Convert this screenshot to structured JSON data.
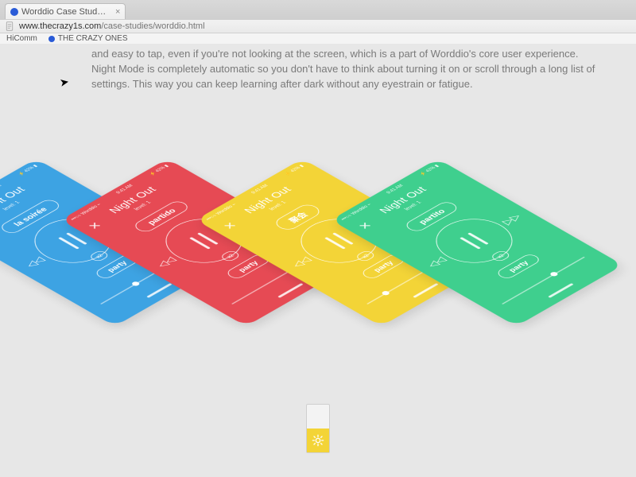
{
  "browser": {
    "tab_title": "Worddio Case Study – The",
    "url_host": "www.thecrazy1s.com",
    "url_path": "/case-studies/worddio.html",
    "bookmarks": [
      {
        "label": "HiComm",
        "has_dot": false
      },
      {
        "label": "THE CRAZY ONES",
        "has_dot": true
      }
    ]
  },
  "copy": {
    "text": "and easy to tap, even if you're not looking at the screen, which is a part of Worddio's core user experience. Night Mode is completely automatic so you don't have to think about turning it on or scroll through a long list of settings. This way you can keep learning after dark without any eyestrain or fatigue."
  },
  "status_bar": {
    "carrier": "•••○○ Worddio ⌁",
    "time": "9:41 AM",
    "battery": "⚡ 42% ▮"
  },
  "screen_common": {
    "title": "Night Out",
    "subtitle": "level: 1",
    "close": "✕",
    "prev": "◁◁",
    "next": "▷▷",
    "badge": "x2"
  },
  "phones": [
    {
      "color": "blue",
      "hex": "#3da3e3",
      "top_word": "la soirée",
      "bottom_word": "party"
    },
    {
      "color": "red",
      "hex": "#e64a54",
      "top_word": "partido",
      "bottom_word": "party"
    },
    {
      "color": "yellow",
      "hex": "#f3d437",
      "top_word": "聚会",
      "bottom_word": "party"
    },
    {
      "color": "green",
      "hex": "#3fcf8e",
      "top_word": "partito",
      "bottom_word": "party"
    }
  ],
  "toggle": {
    "state": "day",
    "active_color": "#f3d437"
  }
}
